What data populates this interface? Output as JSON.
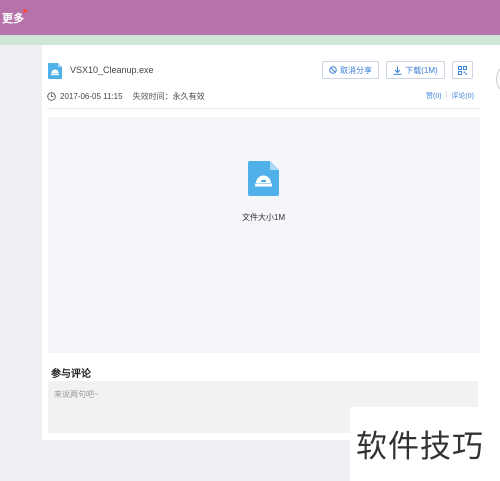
{
  "topbar": {
    "more_label": "更多"
  },
  "file": {
    "name": "VSX10_Cleanup.exe",
    "date": "2017-06-05 11:15",
    "expire_label": "失效时间：",
    "expire_value": "永久有效",
    "size_label": "文件大小1M"
  },
  "actions": {
    "cancel_share": "取消分享",
    "download": "下载(1M)"
  },
  "stats": {
    "likes": "赞(0)",
    "comments": "评论(0)"
  },
  "comment": {
    "title": "参与评论",
    "placeholder": "来说两句吧~"
  },
  "watermark": "软件技巧",
  "colors": {
    "topbar": "#b673ab",
    "accent": "#3b7fd4",
    "file_icon": "#4fb0ea"
  },
  "icons": [
    "file-icon",
    "ban-icon",
    "download-icon",
    "qr-code-icon",
    "clock-icon"
  ]
}
